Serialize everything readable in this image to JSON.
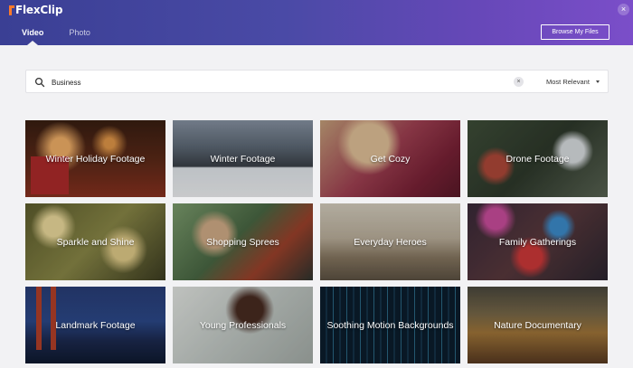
{
  "app": {
    "logo_text": "FlexClip"
  },
  "header": {
    "tabs": [
      {
        "label": "Video",
        "active": true
      },
      {
        "label": "Photo",
        "active": false
      }
    ],
    "browse_button": "Browse My Files",
    "close_icon": "×"
  },
  "search": {
    "value": "Business",
    "clear_icon": "×",
    "sort_label": "Most Relevant"
  },
  "categories": [
    {
      "label": "Winter Holiday Footage"
    },
    {
      "label": "Winter Footage"
    },
    {
      "label": "Get Cozy"
    },
    {
      "label": "Drone Footage"
    },
    {
      "label": "Sparkle and Shine"
    },
    {
      "label": "Shopping Sprees"
    },
    {
      "label": "Everyday Heroes"
    },
    {
      "label": "Family Gatherings"
    },
    {
      "label": "Landmark Footage"
    },
    {
      "label": "Young Professionals"
    },
    {
      "label": "Soothing Motion Backgrounds"
    },
    {
      "label": "Nature Documentary"
    }
  ],
  "colors": {
    "header_start": "#3a3f94",
    "header_end": "#7b4ec9",
    "logo_accent": "#ff7a2a"
  }
}
